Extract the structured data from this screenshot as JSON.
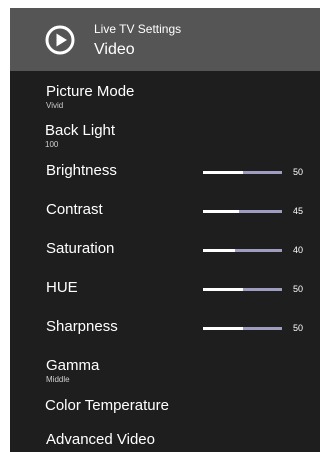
{
  "header": {
    "icon": "play-circle-icon",
    "subtitle": "Live TV Settings",
    "title": "Video"
  },
  "menu": {
    "picture_mode": {
      "label": "Picture Mode",
      "value": "Vivid"
    },
    "back_light": {
      "label": "Back Light",
      "value": "100"
    },
    "brightness": {
      "label": "Brightness",
      "value": "50",
      "level": 50
    },
    "contrast": {
      "label": "Contrast",
      "value": "45",
      "level": 45
    },
    "saturation": {
      "label": "Saturation",
      "value": "40",
      "level": 40
    },
    "hue": {
      "label": "HUE",
      "value": "50",
      "level": 50
    },
    "sharpness": {
      "label": "Sharpness",
      "value": "50",
      "level": 50
    },
    "gamma": {
      "label": "Gamma",
      "value": "Middle"
    },
    "color_temperature": {
      "label": "Color Temperature"
    },
    "advanced_video": {
      "label": "Advanced Video"
    }
  },
  "colors": {
    "panel": "#1e1e1e",
    "header": "#555555",
    "slider_track": "#9f9dbf",
    "slider_fill": "#ffffff"
  }
}
